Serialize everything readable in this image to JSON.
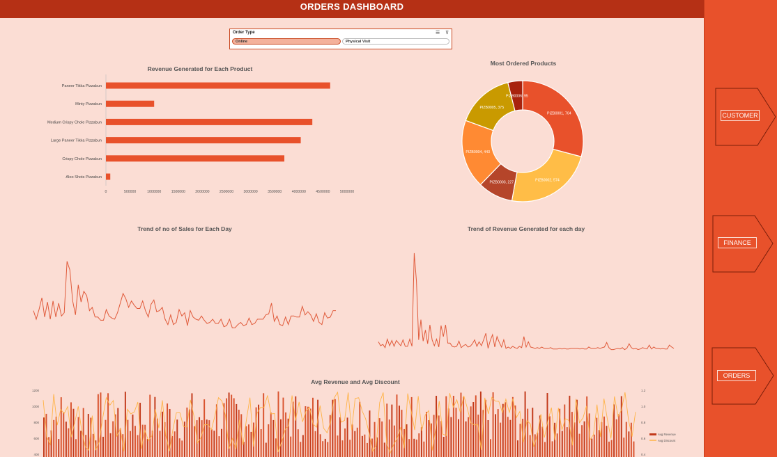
{
  "header": {
    "title": "ORDERS DASHBOARD"
  },
  "slicer": {
    "title": "Order Type",
    "options": [
      "Online",
      "Physical Visit"
    ],
    "selected": "Online"
  },
  "nav": {
    "items": [
      "CUSTOMER",
      "FINANCE",
      "ORDERS"
    ]
  },
  "colors": {
    "accent": "#e8512b",
    "dark": "#b53015",
    "background": "#fbddd4",
    "line": "#e05a3a",
    "amber": "#c99a00",
    "orange": "#ff8a33",
    "yellow": "#ffbd47",
    "rust": "#b5452a",
    "maroon": "#a8220d"
  },
  "chart_data": [
    {
      "type": "bar",
      "title": "Revenue Generated for Each Product",
      "categories": [
        "Paneer Tikka Pizzabun",
        "Minty Pizzabun",
        "Medium Crispy Chole Pizzabun",
        "Large Paneer Tikka Pizzabun",
        "Crispy Chole Pizzabun",
        "Aloo Shots Pizzabun"
      ],
      "values": [
        4650000,
        1000000,
        4280000,
        4040000,
        3700000,
        90000
      ],
      "xlim": [
        0,
        5000000
      ],
      "xticks": [
        "0",
        "500000",
        "1000000",
        "1500000",
        "2000000",
        "2500000",
        "3000000",
        "3500000",
        "4000000",
        "4500000",
        "5000000"
      ]
    },
    {
      "type": "pie",
      "title": "Most Ordered Products",
      "labels": [
        "PIZB0001, 704",
        "PIZB0002, 574",
        "PIZB0003, 227",
        "PIZB0004, 443",
        "PIZB0005, 375",
        "PIZB0006, 95"
      ],
      "values": [
        704,
        574,
        227,
        443,
        375,
        95
      ],
      "colors": [
        "#e8512b",
        "#ffbd47",
        "#b5452a",
        "#ff8a33",
        "#c99a00",
        "#a8220d"
      ]
    },
    {
      "type": "line",
      "title": "Trend of no of Sales for Each Day",
      "values": [
        36,
        28,
        37,
        48,
        30,
        44,
        28,
        45,
        30,
        43,
        31,
        34,
        82,
        74,
        45,
        32,
        60,
        44,
        54,
        50,
        36,
        39,
        30,
        30,
        27,
        27,
        37,
        31,
        29,
        28,
        34,
        43,
        52,
        47,
        39,
        45,
        41,
        38,
        38,
        45,
        36,
        30,
        42,
        46,
        35,
        36,
        39,
        28,
        23,
        32,
        23,
        25,
        37,
        31,
        34,
        22,
        36,
        30,
        28,
        27,
        31,
        27,
        24,
        25,
        28,
        24,
        24,
        28,
        21,
        22,
        28,
        20,
        20,
        23,
        25,
        22,
        23,
        29,
        23,
        24,
        28,
        28,
        28,
        32,
        33,
        43,
        26,
        31,
        23,
        22,
        30,
        23,
        31,
        31,
        30,
        30,
        40,
        32,
        35,
        32,
        26,
        33,
        25,
        23,
        34,
        29,
        30,
        36,
        36
      ],
      "ylim": [
        0,
        100
      ]
    },
    {
      "type": "line",
      "title": "Trend of Revenue Generated for each day",
      "values": [
        22,
        16,
        18,
        13,
        26,
        16,
        24,
        15,
        24,
        20,
        16,
        25,
        15,
        15,
        26,
        15,
        158,
        115,
        25,
        56,
        23,
        40,
        19,
        48,
        25,
        16,
        26,
        14,
        47,
        30,
        48,
        20,
        20,
        15,
        14,
        15,
        23,
        13,
        16,
        18,
        14,
        15,
        19,
        25,
        15,
        22,
        16,
        25,
        35,
        12,
        24,
        33,
        14,
        30,
        21,
        14,
        25,
        12,
        14,
        12,
        15,
        13,
        12,
        15,
        13,
        30,
        14,
        22,
        14,
        13,
        12,
        13,
        12,
        14,
        12,
        12,
        12,
        13,
        11,
        11,
        11,
        12,
        11,
        12,
        11,
        11,
        12,
        12,
        12,
        12,
        11,
        12,
        11,
        11,
        14,
        12,
        12,
        12,
        13,
        12,
        13,
        14,
        21,
        13,
        10,
        10,
        11,
        12,
        11,
        13,
        10,
        12,
        19,
        13,
        11,
        12,
        10,
        11,
        13,
        12,
        11,
        17,
        11,
        14,
        12,
        12,
        11,
        12,
        11,
        11,
        17,
        14,
        12
      ],
      "ylim": [
        0,
        175
      ]
    },
    {
      "type": "bar",
      "title": "Avg Revenue and Avg Discount",
      "series": [
        {
          "name": "Avg Revenue",
          "type": "bar"
        },
        {
          "name": "Avg Discount",
          "type": "line"
        }
      ],
      "yticks_left": [
        "1200",
        "1000",
        "800",
        "600",
        "400"
      ],
      "yticks_right": [
        "1.2",
        "1.0",
        "0.8",
        "0.6",
        "0.4"
      ],
      "legend": "right"
    }
  ]
}
